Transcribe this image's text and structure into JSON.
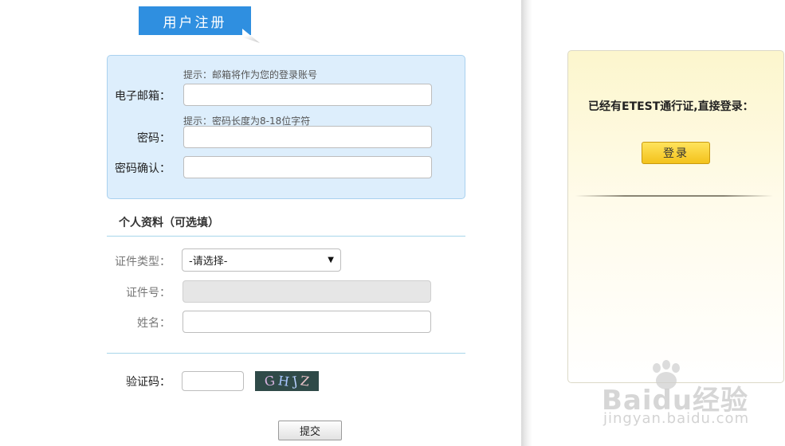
{
  "title": "用户注册",
  "account": {
    "email_hint": "提示：邮箱将作为您的登录账号",
    "email_label": "电子邮箱：",
    "email_value": "",
    "password_hint": "提示：密码长度为8-18位字符",
    "password_label": "密码：",
    "password_value": "",
    "confirm_label": "密码确认：",
    "confirm_value": ""
  },
  "profile": {
    "section_title": "个人资料（可选填）",
    "id_type_label": "证件类型：",
    "id_type_selected": "-请选择-",
    "id_number_label": "证件号：",
    "name_label": "姓名：",
    "name_value": ""
  },
  "captcha": {
    "label": "验证码：",
    "value": "",
    "image_chars": [
      "G",
      "H",
      "J",
      "Z"
    ],
    "image_colors": [
      "#d8b3e0",
      "#a9c7ff",
      "#b8d0ff",
      "#e8c2c8"
    ]
  },
  "submit_label": "提交",
  "login": {
    "prompt": "已经有ETEST通行证,直接登录：",
    "button_label": "登录"
  },
  "watermark": {
    "logo": "Baidu经验",
    "url": "jingyan.baidu.com"
  },
  "colors": {
    "title_tab": "#2f8fe0",
    "account_box_bg": "#ddeefc",
    "login_button": "#f3c21b"
  }
}
